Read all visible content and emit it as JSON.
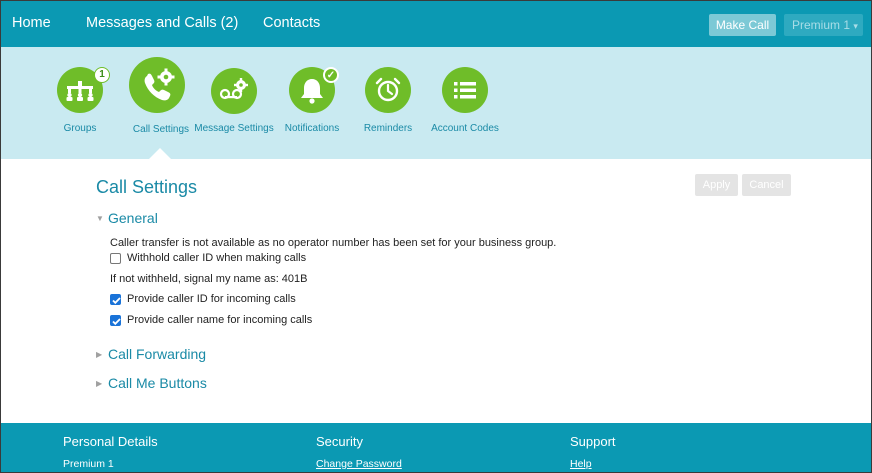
{
  "nav": {
    "home": "Home",
    "messages_calls": "Messages and Calls (2)",
    "contacts": "Contacts",
    "make_call": "Make Call",
    "account": "Premium 1",
    "account_caret": "▾"
  },
  "iconbar": {
    "tiles": [
      {
        "label": "Groups",
        "icon": "groups-icon",
        "badge": "1"
      },
      {
        "label": "Call Settings",
        "icon": "call-settings-icon",
        "selected": true
      },
      {
        "label": "Message Settings",
        "icon": "voicemail-settings-icon"
      },
      {
        "label": "Notifications",
        "icon": "bell-icon",
        "badge": "✓"
      },
      {
        "label": "Reminders",
        "icon": "alarm-clock-icon"
      },
      {
        "label": "Account Codes",
        "icon": "list-icon"
      }
    ]
  },
  "main": {
    "title": "Call Settings",
    "apply": "Apply",
    "cancel": "Cancel",
    "sections": {
      "general": {
        "title": "General",
        "expanded": true,
        "notice": "Caller transfer is not available as no operator number has been set for your business group.",
        "withhold_label": "Withhold caller ID when making calls",
        "withhold_checked": false,
        "signal_name": "If not withheld, signal my name as: 401B",
        "provide_id_label": "Provide caller ID for incoming calls",
        "provide_id_checked": true,
        "provide_name_label": "Provide caller name for incoming calls",
        "provide_name_checked": true
      },
      "forwarding": {
        "title": "Call Forwarding",
        "expanded": false
      },
      "callme": {
        "title": "Call Me Buttons",
        "expanded": false
      }
    }
  },
  "footer": {
    "personal": {
      "heading": "Personal Details",
      "item": "Premium 1"
    },
    "security": {
      "heading": "Security",
      "link": "Change Password"
    },
    "support": {
      "heading": "Support",
      "link": "Help"
    }
  },
  "colors": {
    "brand_teal": "#0b99b3",
    "icon_strip": "#c9eaf1",
    "icon_green": "#6fbd29",
    "link_teal": "#1a8aa6",
    "checkbox_blue": "#1a73d8"
  }
}
